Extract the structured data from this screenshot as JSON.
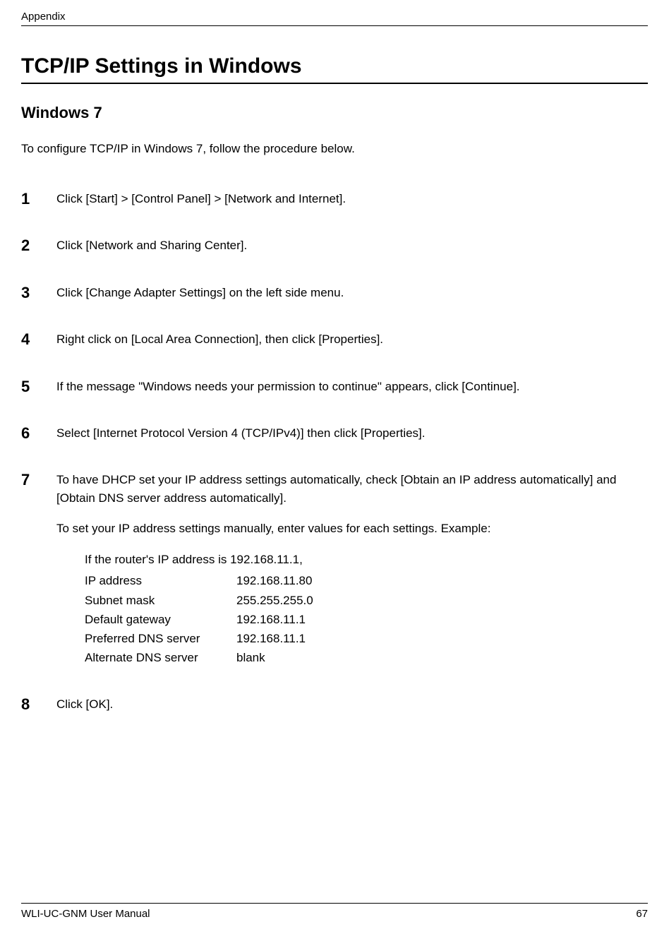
{
  "header": {
    "section": "Appendix"
  },
  "title": "TCP/IP Settings in Windows",
  "subtitle": "Windows 7",
  "intro": "To configure TCP/IP in Windows 7, follow the procedure below.",
  "steps": [
    {
      "num": "1",
      "text": "Click [Start] > [Control Panel] > [Network and Internet]."
    },
    {
      "num": "2",
      "text": "Click [Network and Sharing Center]."
    },
    {
      "num": "3",
      "text": "Click [Change Adapter Settings] on the left side menu."
    },
    {
      "num": "4",
      "text": "Right click on [Local Area Connection], then click [Properties]."
    },
    {
      "num": "5",
      "text": "If the message \"Windows needs your permission to continue\" appears, click [Continue]."
    },
    {
      "num": "6",
      "text": "Select [Internet Protocol Version 4 (TCP/IPv4)] then click [Properties]."
    },
    {
      "num": "7",
      "text": "To have DHCP set your IP address settings automatically, check [Obtain an IP address automatically] and [Obtain DNS server address automatically]."
    },
    {
      "num": "8",
      "text": "Click [OK]."
    }
  ],
  "step7_extra": {
    "manual_intro": "To set your IP address settings manually, enter values for each settings.  Example:",
    "router_line": "If the router's IP address is 192.168.11.1,",
    "rows": [
      {
        "label": "IP address",
        "value": "192.168.11.80"
      },
      {
        "label": "Subnet mask",
        "value": "255.255.255.0"
      },
      {
        "label": "Default gateway",
        "value": "192.168.11.1"
      },
      {
        "label": "Preferred DNS server",
        "value": "192.168.11.1"
      },
      {
        "label": "Alternate DNS server",
        "value": "blank"
      }
    ]
  },
  "footer": {
    "left": "WLI-UC-GNM User Manual",
    "right": "67"
  }
}
